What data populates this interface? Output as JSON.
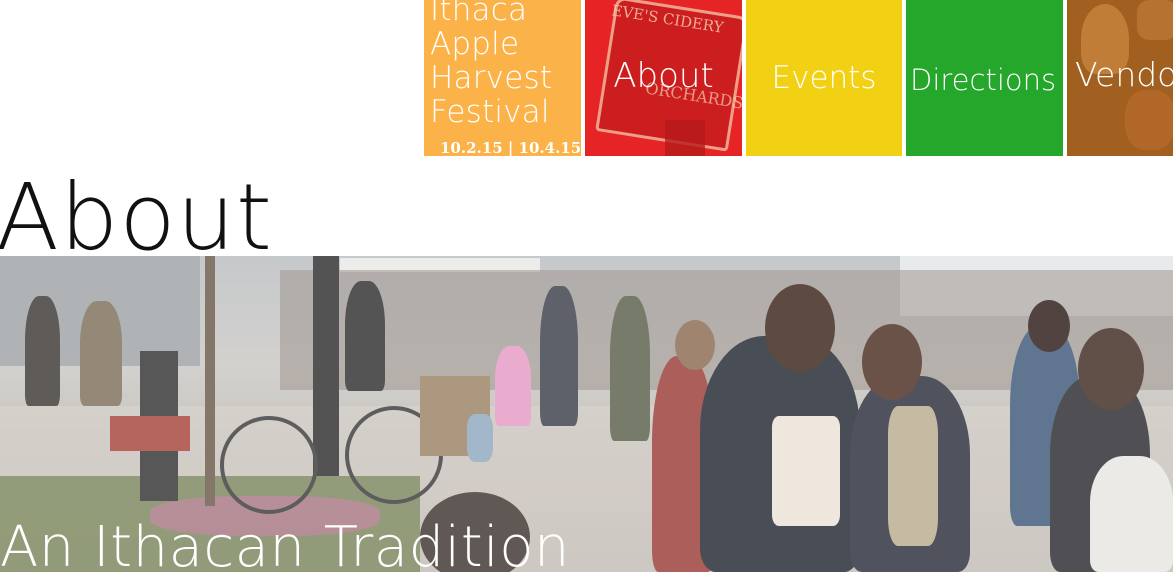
{
  "nav": {
    "logo": {
      "line1": "Ithaca",
      "line2": "Apple",
      "line3": "Harvest",
      "line4": "Festival",
      "dates": "10.2.15 | 10.4.15",
      "color": "#fbb349"
    },
    "about": {
      "label": "About",
      "color": "#e62325",
      "sign_text": "EVE'S CIDERY",
      "sign_text2": "ORCHARDS"
    },
    "events": {
      "label": "Events",
      "color": "#f2d014"
    },
    "directions": {
      "label": "Directions",
      "color": "#24a72b"
    },
    "vendors": {
      "label": "Vendo",
      "color": "#a15f20"
    }
  },
  "page": {
    "title": "About"
  },
  "hero": {
    "caption": "An Ithacan Tradition"
  }
}
